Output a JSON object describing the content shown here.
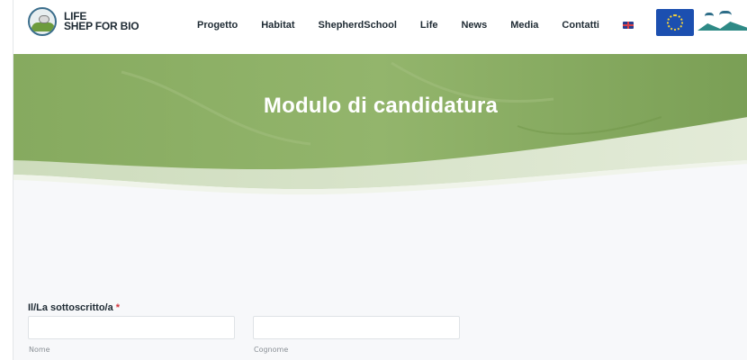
{
  "brand": {
    "line1": "LIFE",
    "line2": "SHEP FOR BIO"
  },
  "nav": {
    "items": [
      "Progetto",
      "Habitat",
      "ShepherdSchool",
      "Life",
      "News",
      "Media",
      "Contatti"
    ],
    "language_icon": "uk-flag-icon"
  },
  "hero": {
    "title": "Modulo di candidatura"
  },
  "form": {
    "label": "Il/La sottoscritto/a",
    "required_mark": "*",
    "first_name": {
      "value": "",
      "sublabel": "Nome"
    },
    "last_name": {
      "value": "",
      "sublabel": "Cognome"
    }
  },
  "colors": {
    "hero_green": "#7fa559",
    "required": "#d2353d",
    "text": "#1e2a33"
  }
}
